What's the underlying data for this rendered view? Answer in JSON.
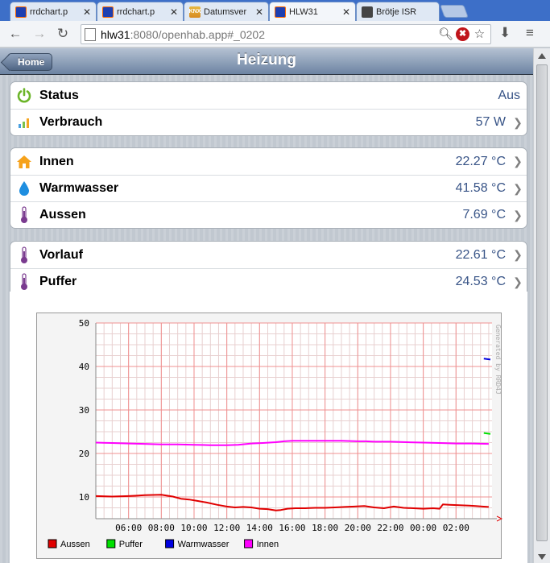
{
  "browser": {
    "tabs": [
      {
        "title": "rrdchart.p",
        "icon": "openhab-icon",
        "active": false
      },
      {
        "title": "rrdchart.p",
        "icon": "openhab-icon",
        "active": false
      },
      {
        "title": "Datumsver",
        "icon": "knx-icon",
        "active": false
      },
      {
        "title": "HLW31",
        "icon": "openhab-icon",
        "active": true
      },
      {
        "title": "Brötje ISR",
        "icon": "broetje-icon",
        "active": false
      }
    ],
    "knx_label": "KNX",
    "url_host": "hlw31",
    "url_rest": ":8080/openhab.app#_0202"
  },
  "header": {
    "home_label": "Home",
    "title": "Heizung"
  },
  "groups": [
    {
      "rows": [
        {
          "name": "status",
          "label": "Status",
          "value": "Aus",
          "icon": "power-icon",
          "chevron": false
        },
        {
          "name": "verbrauch",
          "label": "Verbrauch",
          "value": "57 W",
          "icon": "energy-bars-icon",
          "chevron": true
        }
      ]
    },
    {
      "rows": [
        {
          "name": "innen",
          "label": "Innen",
          "value": "22.27 °C",
          "icon": "house-icon",
          "chevron": true
        },
        {
          "name": "warmwasser",
          "label": "Warmwasser",
          "value": "41.58 °C",
          "icon": "water-drop-icon",
          "chevron": true
        },
        {
          "name": "aussen",
          "label": "Aussen",
          "value": "7.69 °C",
          "icon": "thermometer-icon",
          "chevron": true
        }
      ]
    },
    {
      "rows": [
        {
          "name": "vorlauf",
          "label": "Vorlauf",
          "value": "22.61 °C",
          "icon": "thermometer-icon",
          "chevron": true
        },
        {
          "name": "puffer",
          "label": "Puffer",
          "value": "24.53 °C",
          "icon": "thermometer-icon",
          "chevron": true
        }
      ]
    }
  ],
  "colors": {
    "accent_value": "#385487",
    "aussen": "#e00000",
    "puffer": "#00e000",
    "warmwasser": "#0000e0",
    "innen": "#ff00ff"
  },
  "chart_data": {
    "type": "line",
    "watermark": "Generated by RRD4J",
    "ylim": [
      5,
      50
    ],
    "yticks": [
      10,
      20,
      30,
      40,
      50
    ],
    "xlim": [
      4.0,
      28.2
    ],
    "xticks": [
      6,
      8,
      10,
      12,
      14,
      16,
      18,
      20,
      22,
      24,
      26
    ],
    "xtick_labels": [
      "06:00",
      "08:00",
      "10:00",
      "12:00",
      "14:00",
      "16:00",
      "18:00",
      "20:00",
      "22:00",
      "00:00",
      "02:00"
    ],
    "grid": true,
    "legend": "bottom",
    "series": [
      {
        "name": "Aussen",
        "color": "#e00000",
        "x": [
          4.0,
          5.0,
          6.0,
          6.5,
          7.0,
          8.0,
          8.7,
          9.2,
          9.7,
          10.2,
          10.8,
          11.4,
          12.0,
          12.5,
          13.0,
          13.5,
          14.0,
          14.5,
          15.0,
          15.3,
          15.7,
          16.2,
          16.8,
          17.4,
          18.0,
          18.6,
          19.2,
          19.8,
          20.4,
          21.0,
          21.6,
          22.2,
          22.8,
          23.4,
          24.0,
          24.6,
          25.0,
          25.2,
          25.6,
          26.2,
          26.8,
          27.2,
          27.6,
          28.0
        ],
        "y": [
          10.2,
          10.1,
          10.2,
          10.3,
          10.4,
          10.5,
          10.1,
          9.6,
          9.4,
          9.1,
          8.7,
          8.2,
          7.8,
          7.6,
          7.7,
          7.6,
          7.3,
          7.2,
          6.9,
          7.0,
          7.3,
          7.4,
          7.4,
          7.5,
          7.5,
          7.6,
          7.7,
          7.8,
          7.9,
          7.6,
          7.4,
          7.8,
          7.5,
          7.4,
          7.3,
          7.4,
          7.3,
          8.3,
          8.2,
          8.1,
          8.0,
          7.9,
          7.8,
          7.7
        ]
      },
      {
        "name": "Puffer",
        "color": "#00e000",
        "x": [
          27.7,
          28.1
        ],
        "y": [
          24.7,
          24.5
        ]
      },
      {
        "name": "Warmwasser",
        "color": "#0000e0",
        "x": [
          27.7,
          28.1
        ],
        "y": [
          41.8,
          41.6
        ]
      },
      {
        "name": "Innen",
        "color": "#ff00ff",
        "x": [
          4.0,
          5.0,
          6.0,
          7.0,
          8.0,
          9.0,
          10.0,
          11.0,
          12.0,
          12.7,
          13.5,
          14.2,
          15.0,
          15.5,
          16.0,
          17.0,
          18.0,
          19.0,
          20.0,
          20.5,
          21.0,
          22.0,
          23.0,
          24.0,
          25.0,
          26.0,
          27.0,
          28.0
        ],
        "y": [
          22.5,
          22.4,
          22.3,
          22.2,
          22.1,
          22.1,
          22.0,
          21.9,
          21.9,
          22.0,
          22.3,
          22.4,
          22.6,
          22.8,
          22.9,
          22.9,
          22.9,
          22.9,
          22.8,
          22.8,
          22.7,
          22.7,
          22.6,
          22.5,
          22.4,
          22.3,
          22.3,
          22.2
        ]
      }
    ]
  }
}
